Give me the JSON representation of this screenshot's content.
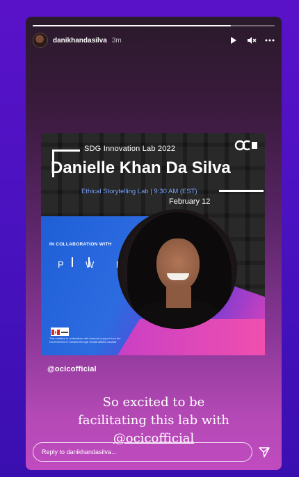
{
  "story": {
    "username": "danikhandasilva",
    "time": "3m",
    "progress": 0.82,
    "icons": [
      "play-icon",
      "mute-icon",
      "more-icon",
      "send-icon"
    ]
  },
  "poster": {
    "lab_label": "SDG Innovation Lab 2022",
    "name": "Danielle Khan Da Silva",
    "subtitle": "Ethical Storytelling Lab | 9:30 AM (EST)",
    "date": "February 12",
    "collab": "IN COLLABORATION WITH",
    "partner": "P W B",
    "fine_print": "This initiative is undertaken with financial support from the Government of Canada through Global Affairs Canada"
  },
  "mention": "@ocicofficial",
  "caption": {
    "line1": "So excited to be",
    "line2": "facilitating this lab with",
    "line3": "@ocicofficial"
  },
  "reply": {
    "placeholder": "Reply to danikhandasilva..."
  },
  "colors": {
    "background": "#4a12c0",
    "accent_blue": "#7aa7ff",
    "pink": "#c04bbf"
  }
}
